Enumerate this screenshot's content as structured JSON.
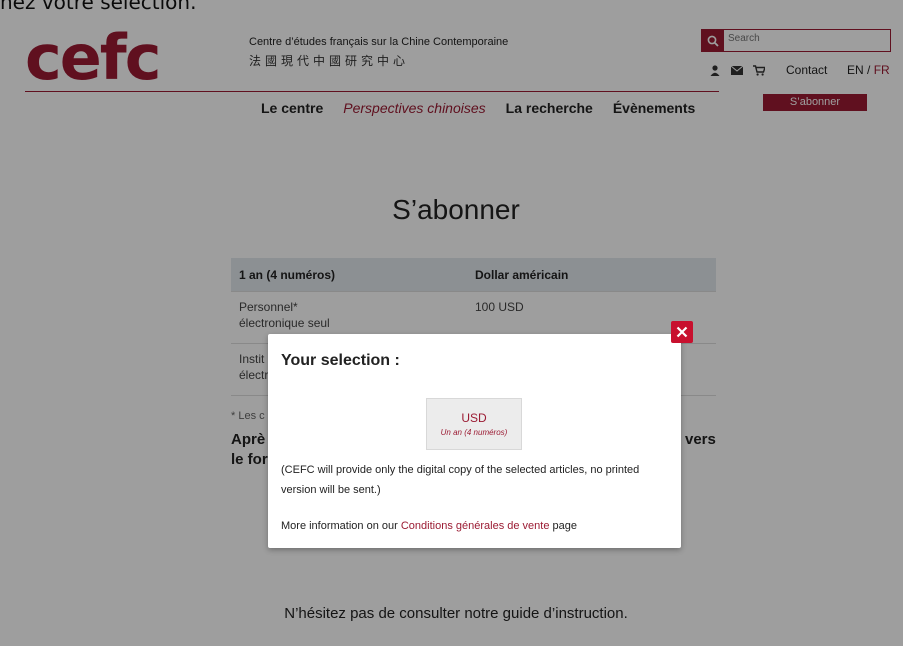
{
  "top_cut_text": "nez votre sélection.",
  "header": {
    "logo": "cefc",
    "org_name": "Centre d’études français sur la Chine Contemporaine",
    "org_name_cn": "法國現代中國研究中心",
    "search_placeholder": "Search",
    "contact_label": "Contact",
    "lang_en": "EN",
    "lang_sep": "/",
    "lang_fr": "FR",
    "subscribe_label": "S’abonner",
    "icons": [
      "user-icon",
      "mail-icon",
      "cart-icon"
    ]
  },
  "nav": {
    "items": [
      "Le centre",
      "Perspectives chinoises",
      "La recherche",
      "Évènements"
    ]
  },
  "main": {
    "title": "S’abonner",
    "table_headers": [
      "1 an (4 numéros)",
      "Dollar américain"
    ],
    "rows": [
      {
        "label_1": "Personnel*",
        "label_2": "électronique seul",
        "price": "100 USD"
      },
      {
        "label_1": "Instit",
        "label_2": "électr",
        "price": ""
      }
    ],
    "footnote": "* Les c",
    "apres_1": "Aprè",
    "apres_2": "le for",
    "apres_right": "vers",
    "guide": "N’hésitez pas de consulter notre guide d’instruction."
  },
  "modal": {
    "title": "Your selection :",
    "option_currency": "USD",
    "option_period": "Un an (4 numéros)",
    "note": "(CEFC will provide only the digital copy of the selected articles, no printed version will be sent.)",
    "more_prefix": "More information on our ",
    "more_link": "Conditions générales de vente",
    "more_suffix": " page"
  },
  "colors": {
    "brand": "#9b1b33",
    "close": "#c8102e"
  }
}
